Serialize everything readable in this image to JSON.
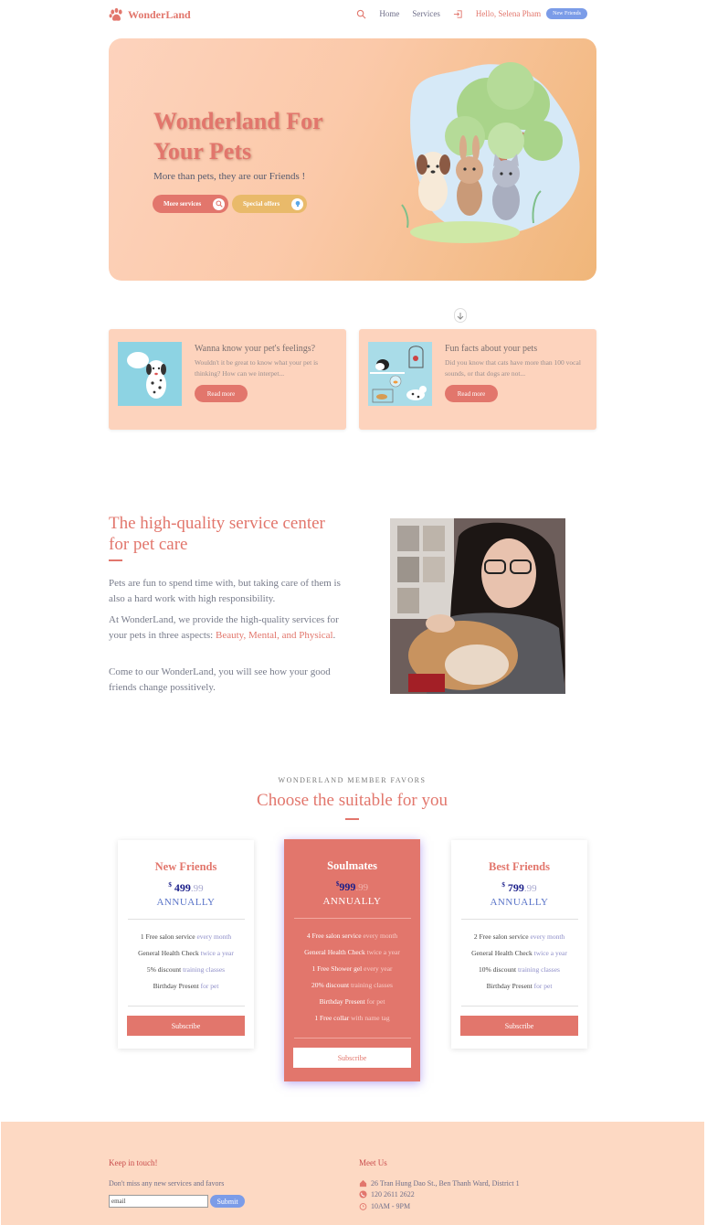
{
  "nav": {
    "logo": "WonderLand",
    "home": "Home",
    "services": "Services",
    "greeting": "Hello, Selena Pham",
    "badge": "New Friends"
  },
  "hero": {
    "title": "Wonderland For Your Pets",
    "subtitle": "More than pets, they are our Friends !",
    "btn_services": "More services",
    "btn_offers": "Special offers"
  },
  "articles": [
    {
      "title": "Wanna know your pet's feelings?",
      "excerpt": "Wouldn't it be great to know what your pet is thinking? How can we interpet...",
      "button": "Read more"
    },
    {
      "title": "Fun facts about your pets",
      "excerpt": "Did you know that cats have more than 100 vocal sounds, or that dogs are not...",
      "button": "Read more"
    }
  ],
  "about": {
    "title": "The high-quality service center for pet care",
    "p1": "Pets are fun to spend time with, but taking care of them is also a hard work with high responsibility.",
    "p2_a": "At WonderLand, we provide the high-quality services for your pets in three aspects: ",
    "p2_hl": "Beauty, Mental, and Physical",
    "p2_b": ".",
    "p3": "Come to our WonderLand, you will see how your good friends change possitively."
  },
  "pricing": {
    "eyebrow": "WONDERLAND MEMBER FAVORS",
    "title": "Choose the suitable for you",
    "plans": [
      {
        "name": "New Friends",
        "currency": "$",
        "price": "499",
        "cents": ".99",
        "period": "ANNUALLY",
        "features": [
          {
            "main": "1 Free salon service",
            "muted": "every month"
          },
          {
            "main": "General Health Check",
            "muted": "twice a year"
          },
          {
            "main": "5% discount",
            "muted": "training classes"
          },
          {
            "main": "Birthday Present",
            "muted": "for pet"
          }
        ],
        "button": "Subscribe"
      },
      {
        "name": "Soulmates",
        "currency": "$",
        "price": "999",
        "cents": ".99",
        "period": "ANNUALLY",
        "features": [
          {
            "main": "4 Free salon service",
            "muted": "every month"
          },
          {
            "main": "General Health Check",
            "muted": "twice a year"
          },
          {
            "main": "1 Free Shower gel",
            "muted": "every year"
          },
          {
            "main": "20% discount",
            "muted": "training classes"
          },
          {
            "main": "Birthday Present",
            "muted": "for pet"
          },
          {
            "main": "1 Free collar",
            "muted": "with name tag"
          }
        ],
        "button": "Subscribe"
      },
      {
        "name": "Best Friends",
        "currency": "$",
        "price": "799",
        "cents": ".99",
        "period": "ANNUALLY",
        "features": [
          {
            "main": "2 Free salon service",
            "muted": "every month"
          },
          {
            "main": "General Health Check",
            "muted": "twice a year"
          },
          {
            "main": "10% discount",
            "muted": "training classes"
          },
          {
            "main": "Birthday Present",
            "muted": "for pet"
          }
        ],
        "button": "Subscribe"
      }
    ]
  },
  "footer": {
    "keep_title": "Keep in touch!",
    "keep_text": "Don't miss any new services and favors",
    "email_value": "email",
    "submit": "Submit",
    "meet_title": "Meet Us",
    "address": "26 Tran Hung Dao St., Ben Thanh Ward, District 1",
    "phone": "120 2611 2622",
    "hours": "10AM - 9PM"
  },
  "colors": {
    "accent": "#e2766c",
    "peach": "#fdd3bd",
    "blue": "#7b9ce8",
    "amber": "#e9ba6a"
  }
}
